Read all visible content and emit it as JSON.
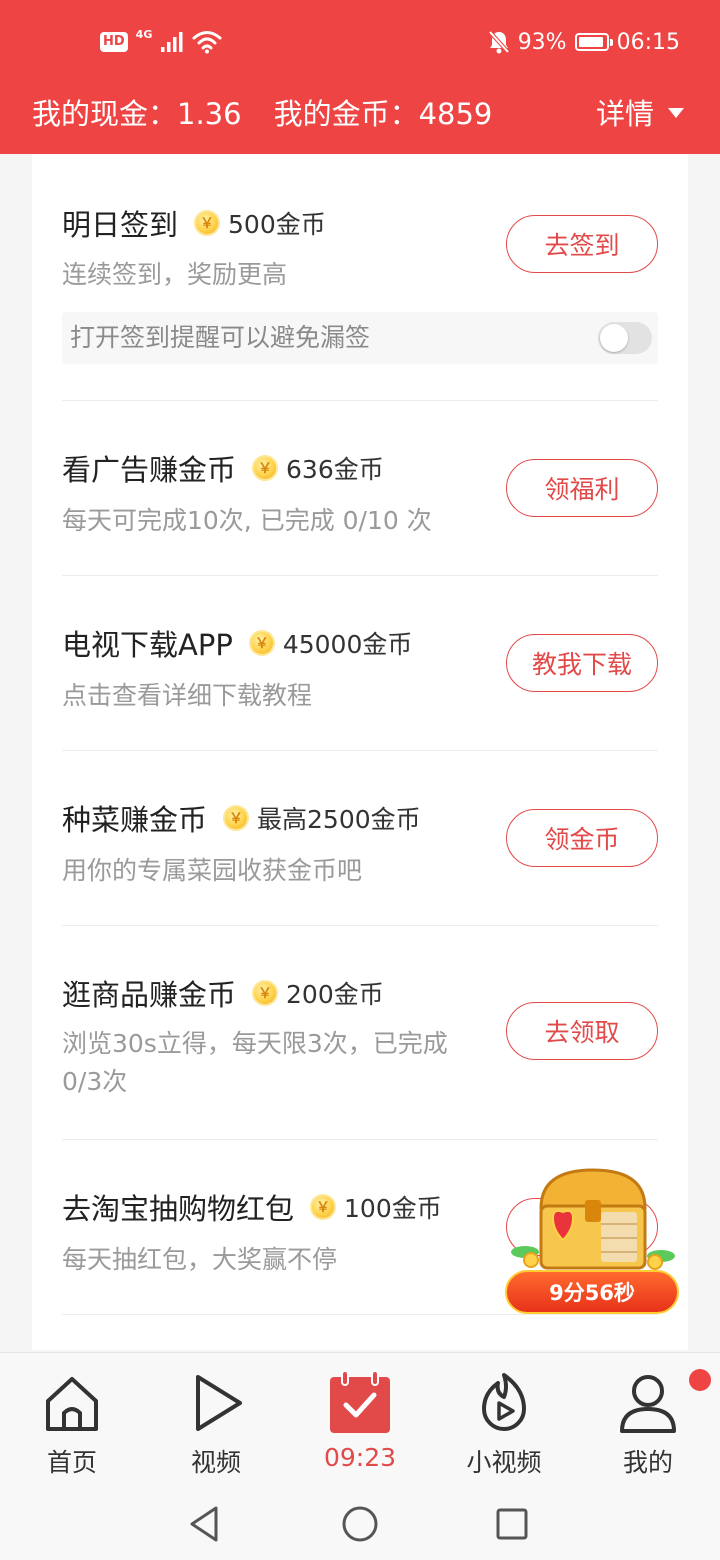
{
  "status_bar": {
    "hd_badge": "HD",
    "network": "4G",
    "battery": "93%",
    "battery_level": 0.93,
    "time": "06:15"
  },
  "header": {
    "cash_label": "我的现金：1.36",
    "coin_label": "我的金币：4859",
    "detail_label": "详情"
  },
  "tasks": [
    {
      "title": "明日签到",
      "reward": "500金币",
      "desc": "连续签到，奖励更高",
      "button": "去签到",
      "reminder": "打开签到提醒可以避免漏签",
      "reminder_on": false
    },
    {
      "title": "看广告赚金币",
      "reward": "636金币",
      "desc": "每天可完成10次, 已完成 0/10 次",
      "button": "领福利"
    },
    {
      "title": "电视下载APP",
      "reward": "45000金币",
      "desc": "点击查看详细下载教程",
      "button": "教我下载"
    },
    {
      "title": "种菜赚金币",
      "reward": "最高2500金币",
      "desc": "用你的专属菜园收获金币吧",
      "button": "领金币"
    },
    {
      "title": "逛商品赚金币",
      "reward": "200金币",
      "desc": "浏览30s立得，每天限3次，已完成0/3次",
      "button": "去领取"
    },
    {
      "title": "去淘宝抽购物红包",
      "reward": "100金币",
      "desc": "每天抽红包，大奖赢不停",
      "button": ""
    }
  ],
  "coin_symbol": "￥",
  "chest": {
    "timer": "9分56秒"
  },
  "bottom_nav": [
    {
      "label": "首页",
      "icon": "home-icon",
      "active": false
    },
    {
      "label": "视频",
      "icon": "play-icon",
      "active": false
    },
    {
      "label": "09:23",
      "icon": "calendar-check-icon",
      "active": true
    },
    {
      "label": "小视频",
      "icon": "short-video-icon",
      "active": false
    },
    {
      "label": "我的",
      "icon": "profile-icon",
      "active": false
    }
  ],
  "colors": {
    "brand_red": "#ee4444",
    "button_red": "#e24a4a",
    "coin_gold": "#ffd24a"
  }
}
